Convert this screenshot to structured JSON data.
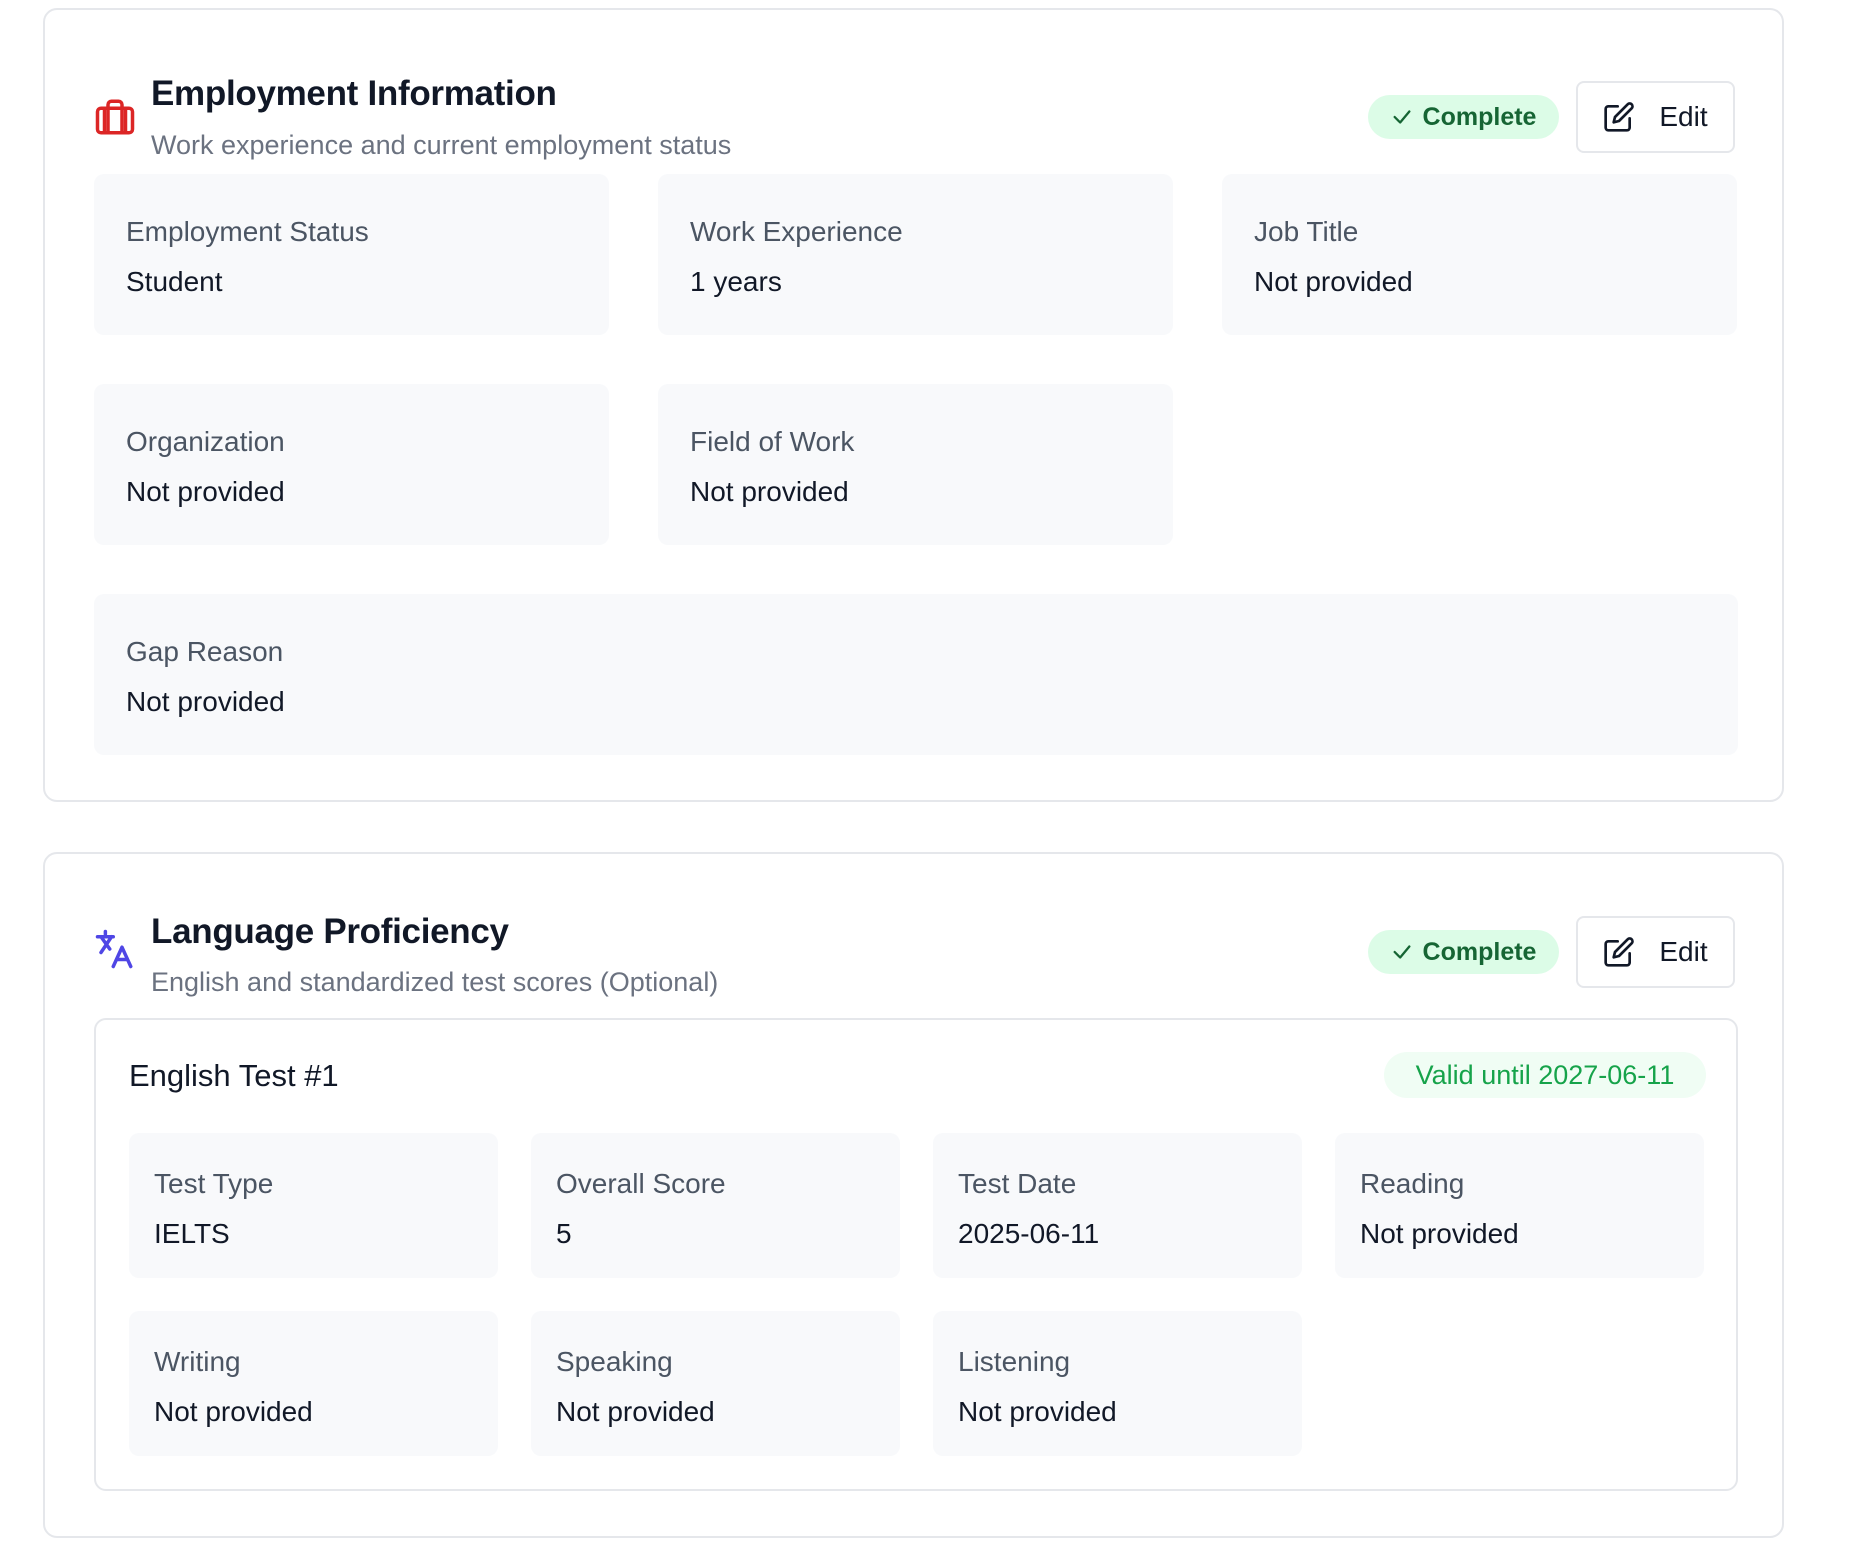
{
  "employment": {
    "title": "Employment Information",
    "subtitle": "Work experience and current employment status",
    "icon": "briefcase-icon",
    "icon_color": "#dc2626",
    "status_badge": "Complete",
    "edit_label": "Edit",
    "fields": [
      {
        "label": "Employment Status",
        "value": "Student"
      },
      {
        "label": "Work Experience",
        "value": "1 years"
      },
      {
        "label": "Job Title",
        "value": "Not provided"
      },
      {
        "label": "Organization",
        "value": "Not provided"
      },
      {
        "label": "Field of Work",
        "value": "Not provided"
      },
      {
        "label": "Gap Reason",
        "value": "Not provided"
      }
    ]
  },
  "language": {
    "title": "Language Proficiency",
    "subtitle": "English and standardized test scores (Optional)",
    "icon": "translate-icon",
    "icon_color": "#4f46e5",
    "status_badge": "Complete",
    "edit_label": "Edit",
    "test": {
      "title": "English Test #1",
      "valid_badge": "Valid until 2027-06-11",
      "fields": [
        {
          "label": "Test Type",
          "value": "IELTS"
        },
        {
          "label": "Overall Score",
          "value": "5"
        },
        {
          "label": "Test Date",
          "value": "2025-06-11"
        },
        {
          "label": "Reading",
          "value": "Not provided"
        },
        {
          "label": "Writing",
          "value": "Not provided"
        },
        {
          "label": "Speaking",
          "value": "Not provided"
        },
        {
          "label": "Listening",
          "value": "Not provided"
        }
      ]
    }
  },
  "colors": {
    "badge_bg": "#dcfce7",
    "badge_text": "#166534",
    "valid_text": "#16a34a",
    "field_bg": "#f8f9fb",
    "border": "#e5e7eb"
  }
}
